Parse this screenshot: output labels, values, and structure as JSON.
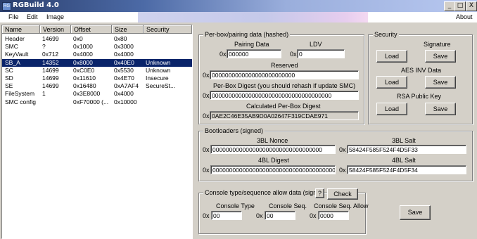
{
  "window": {
    "title": "RGBuild 4.0",
    "controls": [
      "_",
      "□",
      "X"
    ]
  },
  "menu": {
    "items": [
      "File",
      "Edit",
      "Image"
    ],
    "about": "About"
  },
  "list": {
    "columns": [
      "Name",
      "Version",
      "Offset",
      "Size",
      "Security"
    ],
    "rows": [
      [
        "Header",
        "14699",
        "0x0",
        "0x80",
        ""
      ],
      [
        "SMC",
        "?",
        "0x1000",
        "0x3000",
        ""
      ],
      [
        "KeyVault",
        "0x712",
        "0x4000",
        "0x4000",
        ""
      ],
      [
        "SB_A",
        "14352",
        "0x8000",
        "0x40E0",
        "Unknown"
      ],
      [
        "SC",
        "14699",
        "0xC0E0",
        "0x5530",
        "Unknown"
      ],
      [
        "SD",
        "14699",
        "0x11610",
        "0x4E70",
        "Insecure"
      ],
      [
        "SE",
        "14699",
        "0x16480",
        "0xA7AF4",
        "SecureSt..."
      ],
      [
        "FileSystem",
        "1",
        "0x3E8000",
        "0x4000",
        ""
      ],
      [
        "SMC config",
        "",
        "0xF70000 (...",
        "0x10000",
        ""
      ]
    ],
    "selected_index": 3
  },
  "pairing": {
    "title": "Per-box/pairing data (hashed)",
    "pairing_label": "Pairing Data",
    "pairing_prefix": "0x",
    "pairing_value": "000000",
    "ldv_label": "LDV",
    "ldv_prefix": "0x",
    "ldv_value": "0",
    "reserved_label": "Reserved",
    "reserved_prefix": "0x",
    "reserved_value": "0000000000000000000000000",
    "digest_label": "Per-Box Digest (you should rehash if update SMC)",
    "digest_prefix": "0x",
    "digest_value": "000000000000000000000000000000000000",
    "calc_label": "Calculated Per-Box Digest",
    "calc_prefix": "0x",
    "calc_value": "0AE2C46E35AB9D0A02647F319CDAE971"
  },
  "security": {
    "title": "Security",
    "signature_label": "Signature",
    "aes_label": "AES INV Data",
    "rsa_label": "RSA Public Key",
    "load_label": "Load",
    "save_label": "Save"
  },
  "bootloaders": {
    "title": "Bootloaders (signed)",
    "nonce3_label": "3BL Nonce",
    "nonce3_prefix": "0x",
    "nonce3_value": "000000000000000000000000000000000",
    "salt3_label": "3BL Salt",
    "salt3_prefix": "0x",
    "salt3_value": "58424F585F524F4D5F33",
    "digest4_label": "4BL Digest",
    "digest4_prefix": "0x",
    "digest4_value": "0000000000000000000000000000000000000000",
    "salt4_label": "4BL Salt",
    "salt4_prefix": "0x",
    "salt4_value": "58424F585F524F4D5F34"
  },
  "console": {
    "title": "Console type/sequence allow data (sign",
    "help_label": "?",
    "check_label": "Check",
    "type_label": "Console Type",
    "type_prefix": "0x",
    "type_value": "00",
    "seq_label": "Console Seq.",
    "seq_prefix": "0x",
    "seq_value": "00",
    "allow_label": "Console Seq. Allow",
    "allow_prefix": "0x",
    "allow_value": "0000"
  },
  "save_button": "Save"
}
